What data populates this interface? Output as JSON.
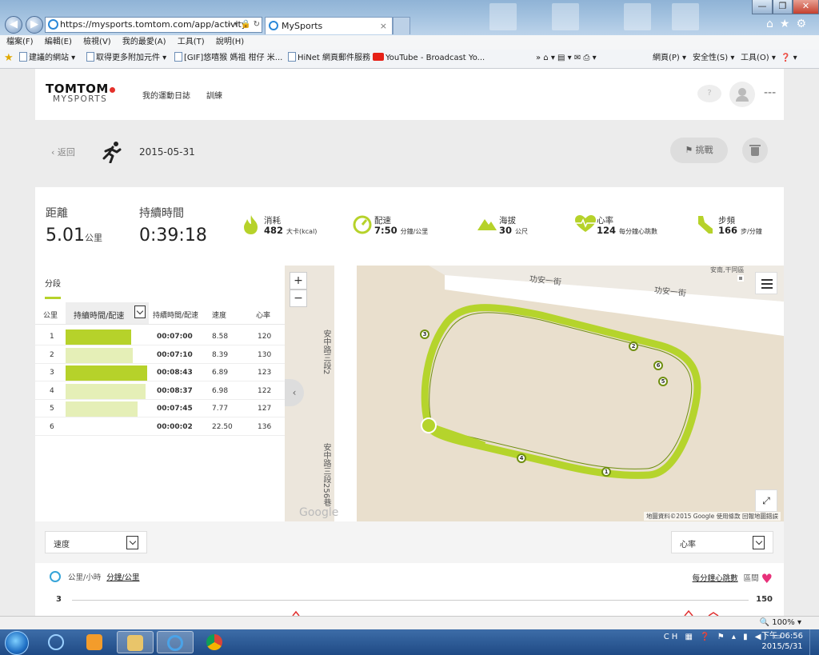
{
  "browser": {
    "url": "https://mysports.tomtom.com/app/activity",
    "tab_title": "MySports",
    "menu": [
      "檔案(F)",
      "編輯(E)",
      "檢視(V)",
      "我的最愛(A)",
      "工具(T)",
      "說明(H)"
    ],
    "favorites": [
      "建議的網站 ▾",
      "取得更多附加元件 ▾",
      "[GIF]悠嘻猴 媽祖 柑仔 米...",
      "HiNet 網頁郵件服務",
      "YouTube - Broadcast Yo..."
    ],
    "toolbar_right": [
      "網頁(P) ▾",
      "安全性(S) ▾",
      "工具(O) ▾"
    ],
    "zoom": "100%"
  },
  "site": {
    "logo_top": "TOMTOM",
    "logo_bottom": "MYSPORTS",
    "nav": [
      "我的運動日誌",
      "訓練"
    ],
    "more": "---"
  },
  "activity": {
    "back": "返回",
    "date": "2015-05-31",
    "challenge": "挑戰"
  },
  "stats": {
    "distance": {
      "label": "距離",
      "value": "5.01",
      "unit": "公里"
    },
    "duration": {
      "label": "持續時間",
      "value": "0:39:18"
    },
    "calories": {
      "label": "消耗",
      "value": "482",
      "unit": "大卡(kcal)"
    },
    "pace": {
      "label": "配速",
      "value": "7:50",
      "unit": "分鐘/公里"
    },
    "elevation": {
      "label": "海拔",
      "value": "30",
      "unit": "公尺"
    },
    "heart_rate": {
      "label": "心率",
      "value": "124",
      "unit": "每分鐘心跳數"
    },
    "cadence": {
      "label": "步頻",
      "value": "166",
      "unit": "步/分鐘"
    }
  },
  "splits": {
    "tab": "分段",
    "headers": {
      "km": "公里",
      "select": "持續時間/配速",
      "duration": "持續時間/配速",
      "speed": "速度",
      "hr": "心率"
    },
    "rows": [
      {
        "km": "1",
        "duration": "00:07:00",
        "speed": "8.58",
        "hr": "120",
        "fill": 0.8,
        "strong": true
      },
      {
        "km": "2",
        "duration": "00:07:10",
        "speed": "8.39",
        "hr": "130",
        "fill": 0.82,
        "strong": false
      },
      {
        "km": "3",
        "duration": "00:08:43",
        "speed": "6.89",
        "hr": "123",
        "fill": 1.0,
        "strong": true
      },
      {
        "km": "4",
        "duration": "00:08:37",
        "speed": "6.98",
        "hr": "122",
        "fill": 0.98,
        "strong": false
      },
      {
        "km": "5",
        "duration": "00:07:45",
        "speed": "7.77",
        "hr": "127",
        "fill": 0.88,
        "strong": false
      },
      {
        "km": "6",
        "duration": "00:00:02",
        "speed": "22.50",
        "hr": "136",
        "fill": 0.0,
        "strong": false
      }
    ]
  },
  "map": {
    "street_1": "功安一街",
    "street_2": "功安一街",
    "street_v1": "安中路三段2",
    "street_v2": "安中路三段256巷",
    "poi": "安南,干同區",
    "watermark": "Google",
    "attribution": "地圖資料©2015 Google   使用條款   回報地圖錯誤",
    "markers": [
      "1",
      "2",
      "3",
      "4",
      "5",
      "6"
    ]
  },
  "lower": {
    "left_select": "速度",
    "right_select": "心率",
    "left_units_a": "公里/小時",
    "left_units_b": "分鐘/公里",
    "right_units_a": "每分鐘心跳數",
    "right_units_b": "區間",
    "axis_left": "3",
    "axis_right": "150"
  },
  "taskbar": {
    "lang": "CH",
    "time": "下午 06:56",
    "date": "2015/5/31"
  },
  "colors": {
    "accent_green": "#b6d22a",
    "light_green": "#e5efb7",
    "route": "#b5d42c",
    "heart": "#e8317a"
  }
}
